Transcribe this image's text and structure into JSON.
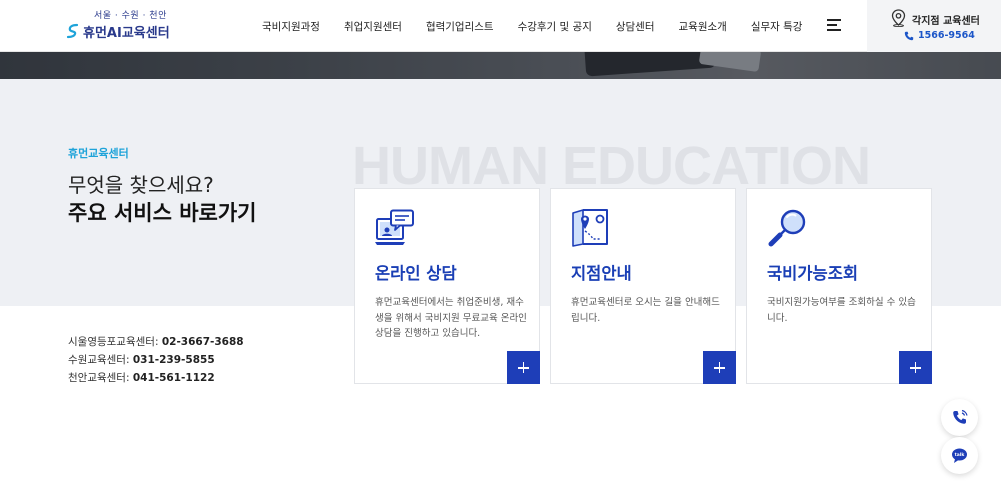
{
  "header": {
    "logo_cities": "서울 · 수원 · 천안",
    "logo_text": "휴먼AI교육센터",
    "nav": [
      "국비지원과정",
      "취업지원센터",
      "협력기업리스트",
      "수강후기 및 공지",
      "상담센터",
      "교육원소개",
      "실무자 특강"
    ],
    "branch_title": "각지점 교육센터",
    "branch_phone": "1566-9564"
  },
  "intro": {
    "eyebrow": "휴먼교육센터",
    "line1": "무엇을 찾으세요?",
    "line2": "주요 서비스 바로가기",
    "bg_word": "HUMAN EDUCATION"
  },
  "contacts": [
    {
      "label": "시울영등포교육센터:",
      "number": "02-3667-3688"
    },
    {
      "label": "수원교육센터:",
      "number": "031-239-5855"
    },
    {
      "label": "천안교육센터:",
      "number": "041-561-1122"
    }
  ],
  "cards": [
    {
      "title": "온라인 상담",
      "desc": "휴먼교육센터에서는 취업준비생, 재수생을 위해서 국비지원 무료교육 온라인 상담을 진행하고 있습니다.",
      "icon": "online-consult-icon"
    },
    {
      "title": "지점안내",
      "desc": "휴먼교육센터로 오시는 길을 안내해드립니다.",
      "icon": "map-pin-icon"
    },
    {
      "title": "국비가능조회",
      "desc": "국비지원가능여부를 조회하실 수 있습니다.",
      "icon": "magnifier-icon"
    }
  ],
  "colors": {
    "brand": "#2a3a8c",
    "accent_blue": "#1e3eb8",
    "eyebrow": "#1ea3d9",
    "band_bg": "#eef0f4"
  },
  "floating": [
    "phone-icon",
    "talk-icon"
  ]
}
